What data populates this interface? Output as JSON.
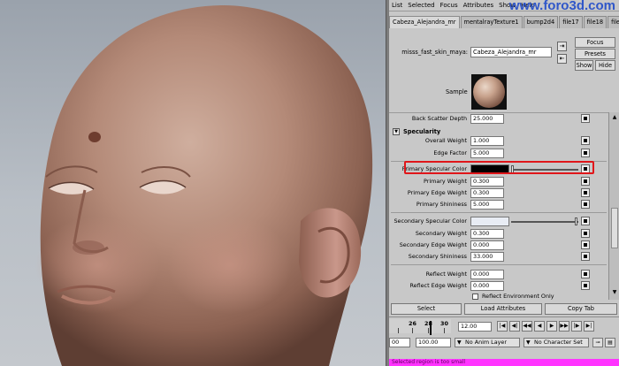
{
  "menu": {
    "items": [
      "List",
      "Selected",
      "Focus",
      "Attributes",
      "Show",
      "Help"
    ]
  },
  "watermark": "www.foro3d.com",
  "tabs": [
    "Cabeza_Alejandra_mr",
    "mentalrayTexture1",
    "bump2d4",
    "file17",
    "file18",
    "file1"
  ],
  "shader": {
    "label": "misss_fast_skin_maya:",
    "value": "Cabeza_Alejandra_mr",
    "focus": "Focus",
    "presets": "Presets",
    "show": "Show",
    "hide": "Hide"
  },
  "sample_label": "Sample",
  "attributes": {
    "back_scatter_depth": {
      "label": "Back Scatter Depth",
      "value": "25.000"
    },
    "specularity_header": "Specularity",
    "overall_weight": {
      "label": "Overall Weight",
      "value": "1.000"
    },
    "edge_factor": {
      "label": "Edge Factor",
      "value": "5.000"
    },
    "primary_specular_color": {
      "label": "Primary Specular Color",
      "color": "#000000"
    },
    "primary_weight": {
      "label": "Primary Weight",
      "value": "0.300"
    },
    "primary_edge_weight": {
      "label": "Primary Edge Weight",
      "value": "0.300"
    },
    "primary_shininess": {
      "label": "Primary Shininess",
      "value": "5.000"
    },
    "secondary_specular_color": {
      "label": "Secondary Specular Color",
      "color": "#e8ecf4"
    },
    "secondary_weight": {
      "label": "Secondary Weight",
      "value": "0.300"
    },
    "secondary_edge_weight": {
      "label": "Secondary Edge Weight",
      "value": "0.000"
    },
    "secondary_shininess": {
      "label": "Secondary Shininess",
      "value": "33.000"
    },
    "reflect_weight": {
      "label": "Reflect Weight",
      "value": "0.000"
    },
    "reflect_edge_weight": {
      "label": "Reflect Edge Weight",
      "value": "0.000"
    },
    "reflect_environment_only": {
      "label": "Reflect Environment Only"
    }
  },
  "bottom_buttons": {
    "select": "Select",
    "load_attributes": "Load Attributes",
    "copy_tab": "Copy Tab"
  },
  "timeline": {
    "ruler_numbers": [
      "26",
      "28",
      "30"
    ],
    "current_frame": "12.00",
    "range_start": "00",
    "range_end": "100.00",
    "anim_layer": "No Anim Layer",
    "character_set": "No Character Set"
  },
  "status": "Selected region is too small",
  "colors": {
    "highlight": "#e0161a",
    "status_bar": "#ff33ff",
    "watermark": "#3057c9"
  }
}
